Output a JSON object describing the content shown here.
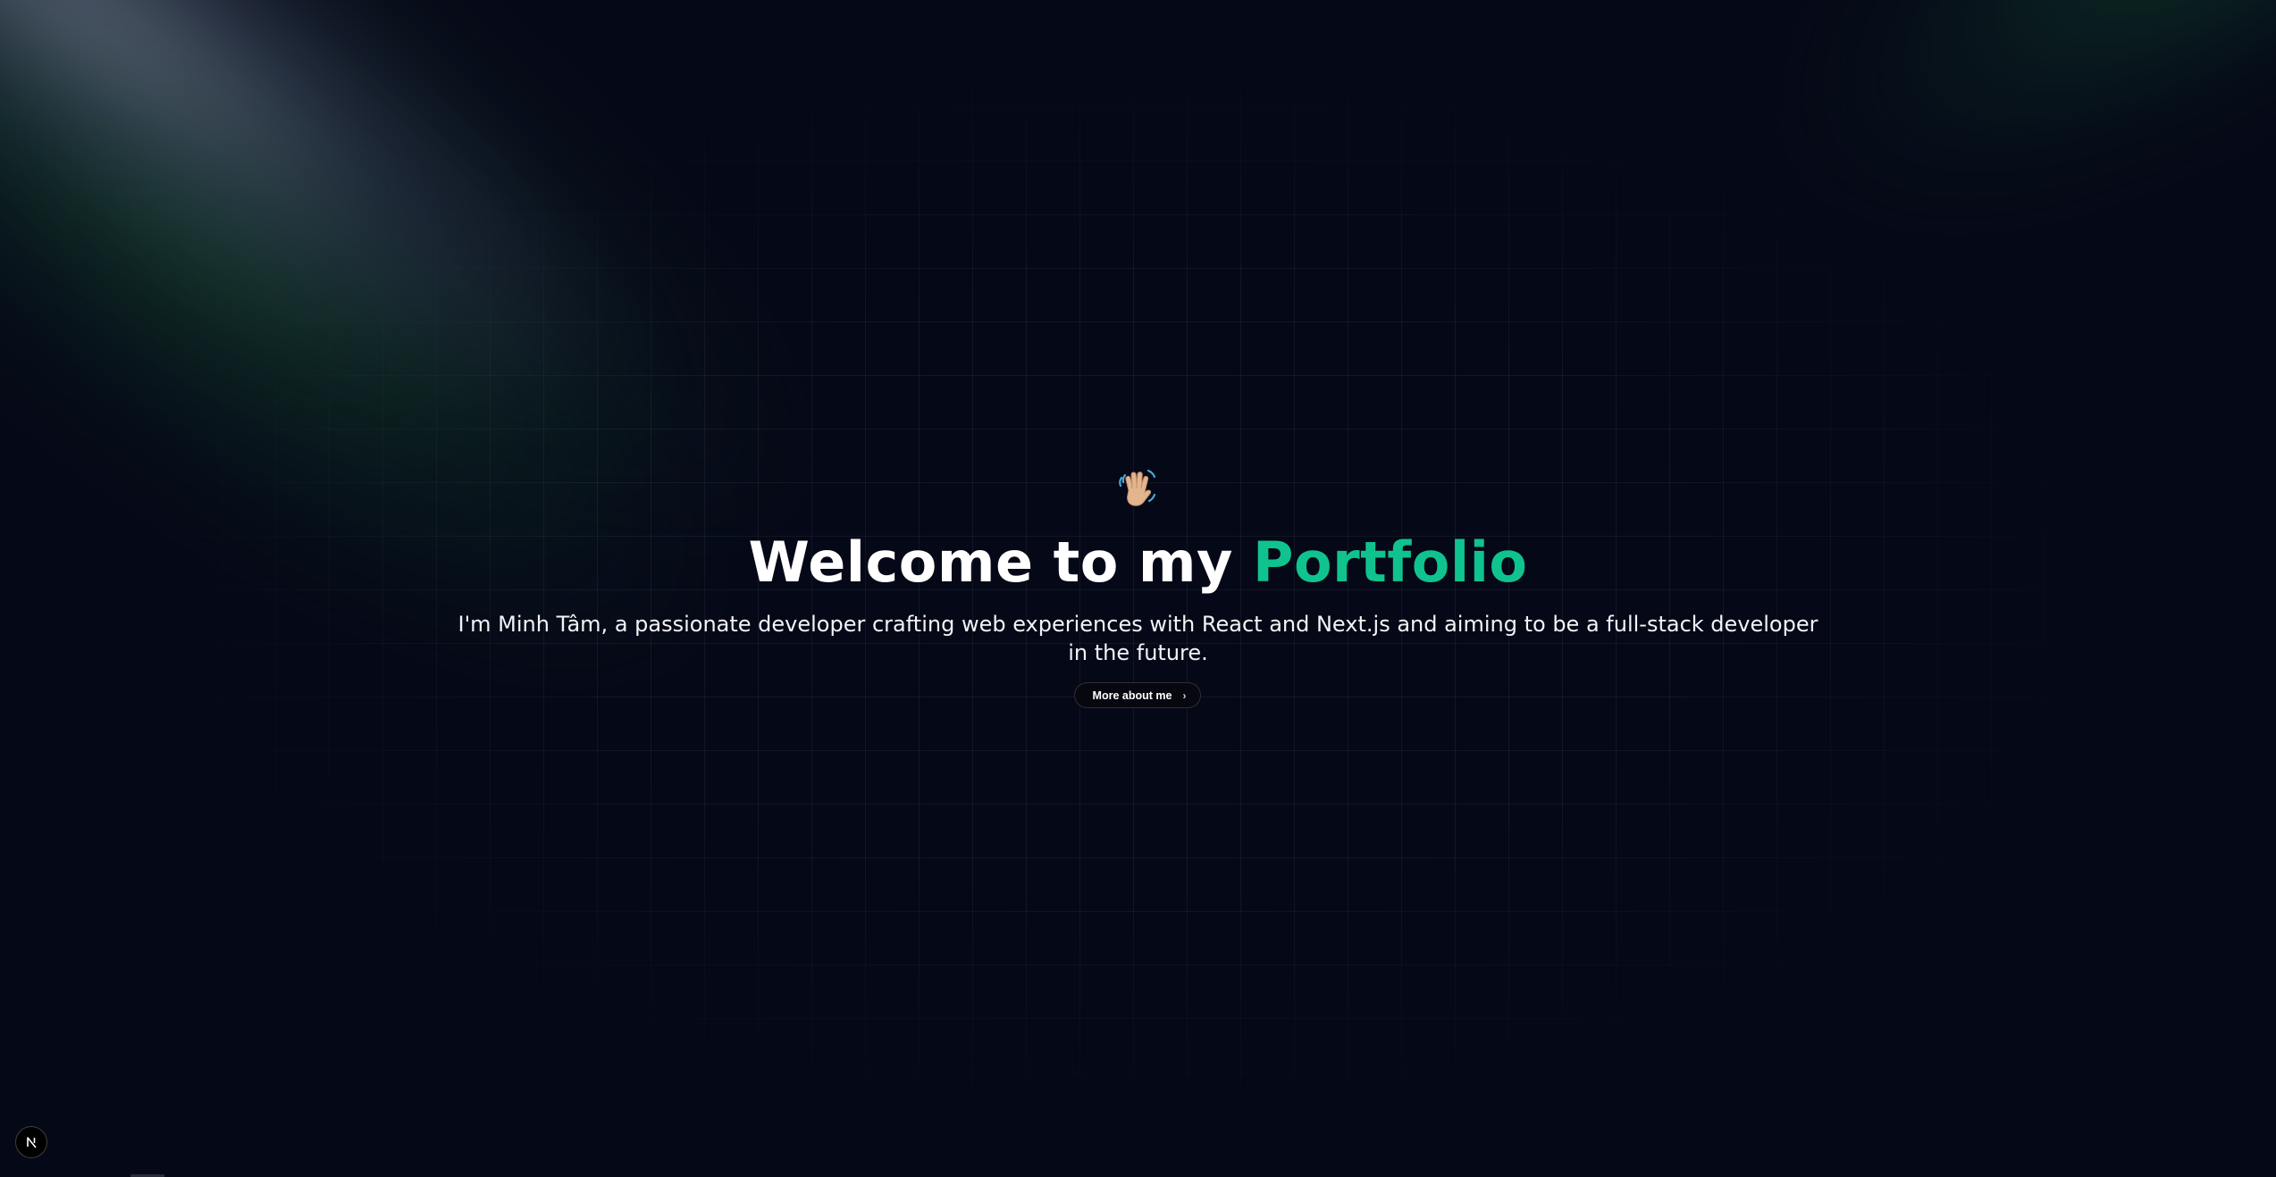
{
  "hero": {
    "emoji": "👋🏼",
    "title_prefix": "Welcome to my",
    "title_accent": "Portfolio",
    "subtitle": "I'm Minh Tâm, a passionate developer crafting web experiences with React and Next.js and aiming to be a full-stack developer in the future.",
    "cta_label": "More about me"
  },
  "icons": {
    "cta": "chevron-right-icon",
    "dev_badge": "nextjs-logo-icon",
    "hero": "waving-hand-icon"
  },
  "colors": {
    "background": "#050817",
    "accent": "#10c38e",
    "text": "#ffffff",
    "button_bg": "#07080f"
  }
}
